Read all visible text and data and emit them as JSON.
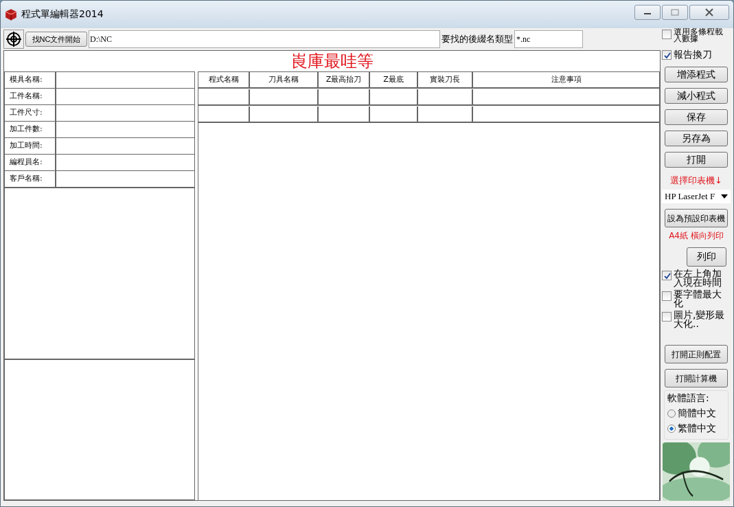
{
  "window": {
    "title": "程式單編輯器2014"
  },
  "toolbar": {
    "find_button": "找NC文件開始",
    "path": "D:\\NC",
    "ext_label": "要找的後綴名類型",
    "ext_value": "*.nc",
    "multi_checkbox": {
      "label": "選用多條程載入數據",
      "checked": false
    }
  },
  "sheet_title": "崀庫最哇等",
  "info_fields": [
    {
      "label": "模具名稱:"
    },
    {
      "label": "工件名稱:"
    },
    {
      "label": "工件尺寸:"
    },
    {
      "label": "加工件數:"
    },
    {
      "label": "加工時間:"
    },
    {
      "label": "編程員名:"
    },
    {
      "label": "客戶名稱:"
    }
  ],
  "table": {
    "columns": [
      "程式名稱",
      "刀具名稱",
      "Z最高抬刀",
      "Z最底",
      "實裝刀長",
      "注意事項"
    ]
  },
  "sidebar": {
    "report_checkbox": {
      "label": "報告換刀",
      "checked": true
    },
    "buttons": [
      "增添程式",
      "減小程式",
      "保存",
      "另存為",
      "打開"
    ],
    "printer_label": "選擇印表機↓",
    "printer": "HP LaserJet F",
    "default_button": "設為預設印表機",
    "paper_label": "A4紙 橫向列印",
    "print_button": "列印",
    "options": [
      {
        "label": "在左上角加入現在時間",
        "checked": true
      },
      {
        "label": "要字體最大化",
        "checked": false
      },
      {
        "label": "圖片,變形最大化..",
        "checked": false
      }
    ],
    "tool_buttons": [
      "打開正則配置",
      "打開計算機"
    ],
    "language": {
      "title": "軟體語言:",
      "options": [
        {
          "label": "簡體中文",
          "selected": false
        },
        {
          "label": "繁體中文",
          "selected": true
        }
      ]
    }
  }
}
